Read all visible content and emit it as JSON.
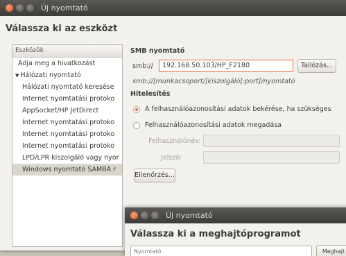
{
  "window1": {
    "title": "Új nyomtató",
    "heading": "Válassza ki az eszközt",
    "list_header": "Eszközök",
    "items": [
      "Adja meg a hivatkozást",
      "Hálózati nyomtató",
      "Hálózati nyomtató keresése",
      "Internet nyomtatási protoko",
      "AppSocket/HP JetDirect",
      "Internet nyomtatási protoko",
      "Internet nyomtatási protoko",
      "Internet nyomtatási protoko",
      "LPD/LPR kiszolgáló vagy nyor",
      "Windows nyomtató SAMBA r"
    ],
    "smb_title": "SMB nyomtató",
    "smb_prefix": "smb://",
    "smb_value": "192.168.50.103/HP_F2180",
    "browse_label": "Tallózás...",
    "smb_hint": "smb://[munkacsoport/]kiszolgáló[:port]/nyomtató",
    "auth_title": "Hitelesítés",
    "radio1_label": "A felhasználóazonosítási adatok bekérése, ha szükséges",
    "radio2_label": "Felhasználóazonosítási adatok megadása",
    "username_label": "Felhasználónév:",
    "password_label": "Jelszó:",
    "check_label": "Ellenőrzés..."
  },
  "window2": {
    "title": "Új nyomtató",
    "heading": "Válassza ki a meghajtóprogramot",
    "partial_label": "Nyomtató",
    "partial_button": "Meghajt"
  },
  "colors": {
    "accent": "#e46a3c",
    "titlebar": "#3d3c38",
    "window_bg": "#f2f1ee"
  }
}
